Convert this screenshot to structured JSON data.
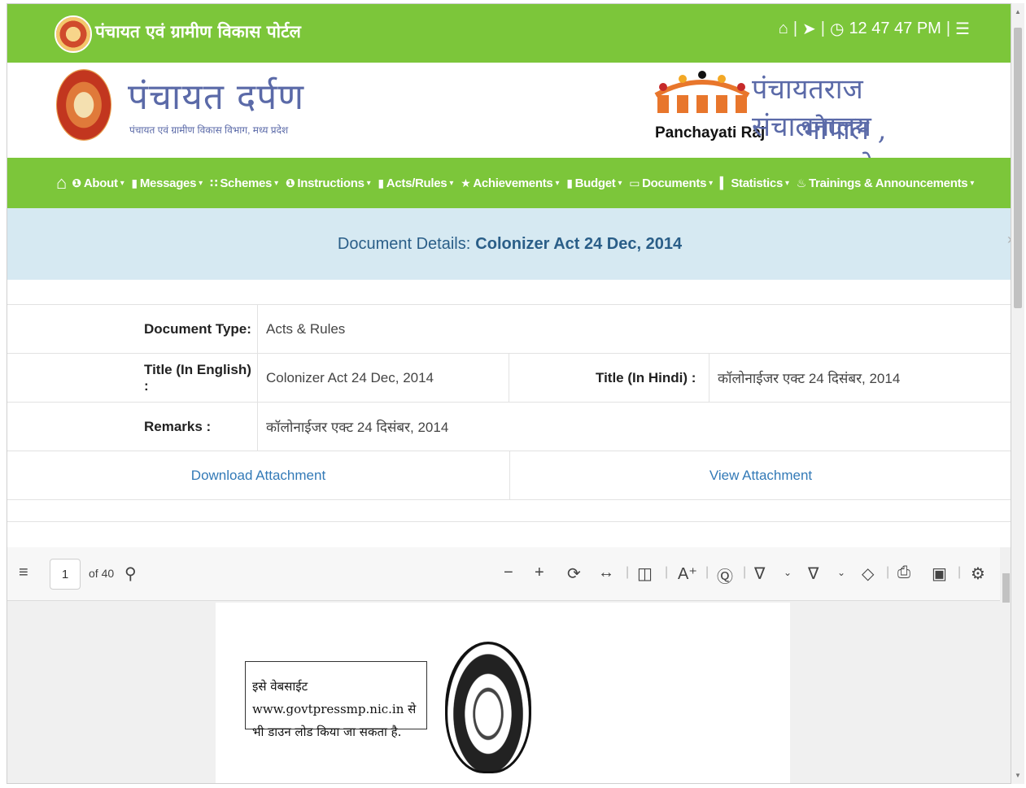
{
  "topbar": {
    "portal_title": "पंचायत एवं ग्रामीण विकास पोर्टल",
    "time": "12  47  47 PM",
    "icons": [
      "home-icon",
      "sign-in-icon",
      "clock-icon",
      "menu-icon"
    ]
  },
  "banner": {
    "brand_title": "पंचायत दर्पण",
    "brand_subtitle": "पंचायत एवं ग्रामीण विकास विभाग, मध्य प्रदेश",
    "logo_text": "Panchayati Raj",
    "directorate": "पंचायतराज संचालनालय",
    "city": "भोपाल , मध्यप्रदेश"
  },
  "nav": [
    {
      "label": "About",
      "icon": "info-icon"
    },
    {
      "label": "Messages",
      "icon": "comment-icon"
    },
    {
      "label": "Schemes",
      "icon": "grid-icon"
    },
    {
      "label": "Instructions",
      "icon": "info-icon"
    },
    {
      "label": "Acts/Rules",
      "icon": "file-icon"
    },
    {
      "label": "Achievements",
      "icon": "star-icon"
    },
    {
      "label": "Budget",
      "icon": "file-icon"
    },
    {
      "label": "Documents",
      "icon": "folder-icon"
    },
    {
      "label": "Statistics",
      "icon": "bar-chart-icon"
    },
    {
      "label": "Trainings & Announcements",
      "icon": "fire-icon"
    }
  ],
  "details": {
    "heading_prefix": "Document Details:",
    "heading_value": "Colonizer Act 24 Dec, 2014",
    "doc_type_label": "Document Type:",
    "doc_type_value": "Acts & Rules",
    "title_en_label": "Title (In English) :",
    "title_en_value": "Colonizer Act 24 Dec, 2014",
    "title_hi_label": "Title (In Hindi) :",
    "title_hi_value": "कॉलोनाईजर एक्ट 24 दिसंबर, 2014",
    "remarks_label": "Remarks :",
    "remarks_value": "कॉलोनाईजर एक्ट 24 दिसंबर, 2014",
    "download_link": "Download Attachment",
    "view_link": "View Attachment"
  },
  "pdf": {
    "page_value": "1",
    "page_total": "of 40",
    "notice_line1": "इसे वेबसाईट www.govtpressmp.nic.in से",
    "notice_line2": "भी डाउन लोड किया जा सकता है."
  },
  "colors": {
    "green": "#7cc63a",
    "heading_bg": "#d6e9f2",
    "link": "#337ab7"
  }
}
